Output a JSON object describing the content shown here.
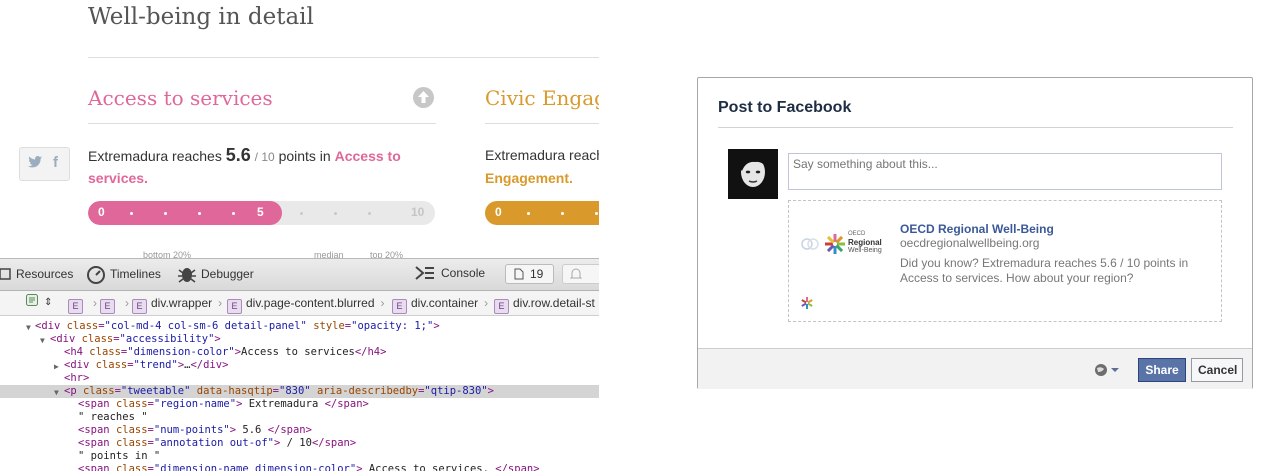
{
  "page": {
    "title": "Well-being in detail",
    "access": {
      "heading": "Access to services",
      "statement_prefix": "Extremadura reaches",
      "points": "5.6",
      "out_of": "/ 10",
      "points_in": "points in",
      "dimension_line1": "Access to",
      "dimension_line2": "services.",
      "bar": {
        "value": 5.6,
        "start_label": "0",
        "mid_label": "5",
        "end_label": "10"
      },
      "scale": {
        "bottom": "bottom 20%",
        "median": "median",
        "top": "top 20%"
      }
    },
    "civic": {
      "heading": "Civic Engagement",
      "statement_prefix": "Extremadura reaches",
      "dimension_line2": "Engagement.",
      "bar": {
        "start_label": "0"
      }
    },
    "share": {
      "twitter": "t",
      "facebook": "f"
    },
    "colors": {
      "access": "#e0679a",
      "civic": "#d99a2b"
    }
  },
  "inspector": {
    "tabs": {
      "resources": "Resources",
      "timelines": "Timelines",
      "debugger": "Debugger",
      "console": "Console",
      "issues_count": "19"
    },
    "breadcrumbs": [
      "div.wrapper",
      "div.page-content.blurred",
      "div.container",
      "div.row.detail-st"
    ],
    "badge_letter": "E",
    "code": {
      "l1_class": "col-md-4 col-sm-6 detail-panel",
      "l1_style": "opacity: 1;",
      "l2_class": "accessibility",
      "l3_class": "dimension-color",
      "l3_text": "Access to services",
      "l4_class": "trend",
      "l4_ellipsis": "…",
      "l6_class": "tweetable",
      "l6_qtip": "830",
      "l6_describedby": "qtip-830",
      "l7_class": "region-name",
      "l7_text": " Extremadura ",
      "l8_text": "\" reaches \"",
      "l9_class": "num-points",
      "l9_text": " 5.6 ",
      "l10_class": "annotation out-of",
      "l10_text": " / 10",
      "l11_text": "\" points in \"",
      "l12_class": "dimension-name dimension-color",
      "l12_text": " Access to services. "
    }
  },
  "facebook": {
    "title": "Post to Facebook",
    "input_placeholder": "Say something about this...",
    "preview": {
      "title": "OECD Regional Well-Being",
      "url": "oecdregionalwellbeing.org",
      "description": "Did you know? Extremadura reaches 5.6 / 10 points in Access to services. How about your region?",
      "logo_oecd": "OECD",
      "logo_regional": "Regional",
      "logo_wellbeing": "Well-Being"
    },
    "share_label": "Share",
    "cancel_label": "Cancel"
  }
}
